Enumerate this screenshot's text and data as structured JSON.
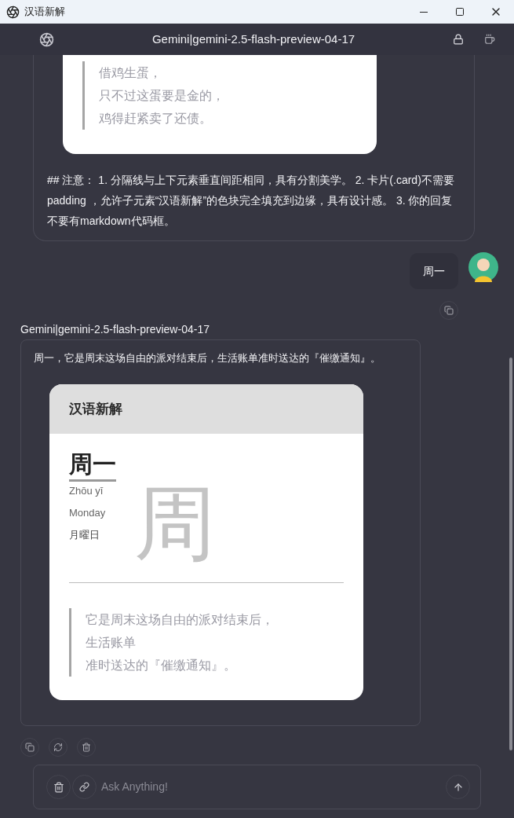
{
  "window": {
    "title": "汉语新解"
  },
  "header": {
    "title": "Gemini|gemini-2.5-flash-preview-04-17"
  },
  "messages": [
    {
      "kind": "assistant",
      "card": {
        "quote_lines": [
          "借鸡生蛋，",
          "只不过这蛋要是金的，",
          "鸡得赶紧卖了还债。"
        ]
      },
      "text": "## 注意： 1. 分隔线与上下元素垂直间距相同，具有分割美学。 2. 卡片(.card)不需要 padding ，允许子元素“汉语新解”的色块完全填充到边缘，具有设计感。 3. 你的回复不要有markdown代码框。"
    },
    {
      "kind": "user",
      "text": "周一"
    },
    {
      "kind": "assistant",
      "author": "Gemini|gemini-2.5-flash-preview-04-17",
      "text": "周一，它是周末这场自由的派对结束后，生活账单准时送达的『催缴通知』。",
      "card": {
        "title": "汉语新解",
        "word": "周一",
        "pinyin": "Zhōu yī",
        "english": "Monday",
        "japanese": "月曜日",
        "watermark": "周",
        "quote_lines": [
          "它是周末这场自由的派对结束后，",
          "生活账单",
          "准时送达的『催缴通知』。"
        ]
      }
    }
  ],
  "composer": {
    "placeholder": "Ask Anything!"
  }
}
